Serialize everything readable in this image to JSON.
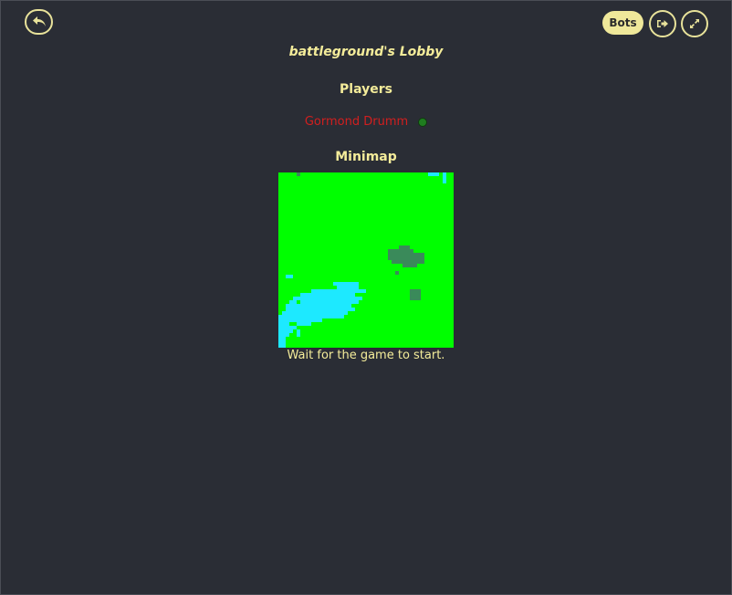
{
  "header": {
    "bots_label": "Bots",
    "icons": {
      "back": "undo-arrow-icon",
      "exit": "exit-door-icon",
      "fullscreen": "expand-icon"
    }
  },
  "lobby": {
    "title": "battleground's Lobby",
    "players_heading": "Players",
    "players": [
      {
        "name": "Gormond Drumm",
        "name_color": "#d21f1f",
        "status_color": "#1f7d1f"
      }
    ],
    "minimap_heading": "Minimap",
    "status_text": "Wait for the game to start."
  },
  "colors": {
    "background": "#2a2d35",
    "accent": "#f4ec9a",
    "minimap_grass": "#00ff00",
    "minimap_water": "#1de9ff",
    "minimap_forest": "#3a8a5a"
  }
}
